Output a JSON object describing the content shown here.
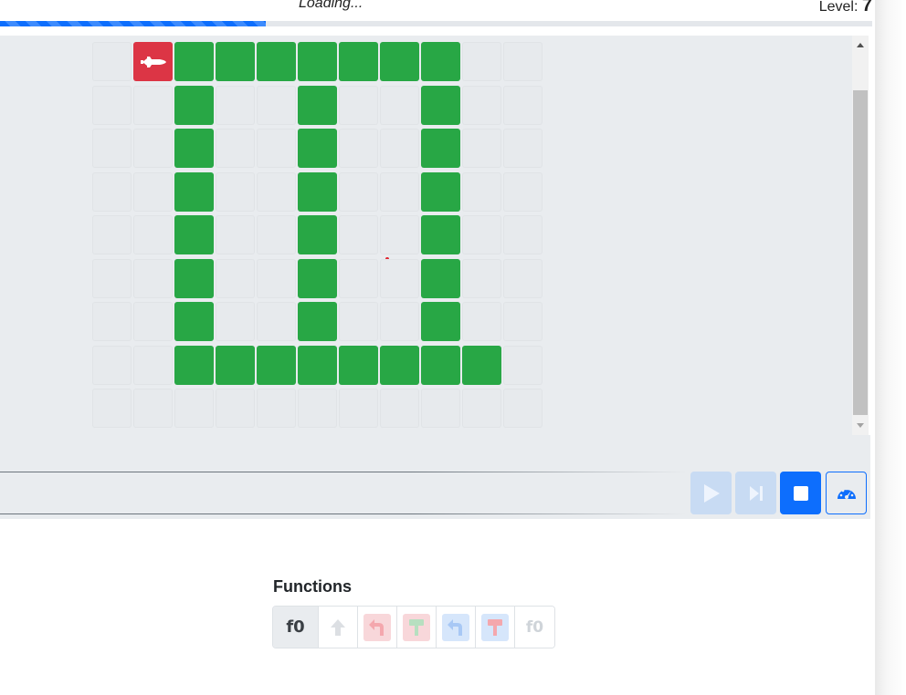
{
  "header": {
    "loading_text": "Loading...",
    "level_label": "Level:",
    "level_value": "7",
    "progress_fraction": 0.305
  },
  "board": {
    "cols": 11,
    "rows": 9,
    "grid": [
      "erggggggge",
      "eeg.eg..ge",
      "eeg.eg..ge",
      "eeg.eg..ge",
      "eeg.eg..ge",
      "eeg.eg..ge",
      "eeg.eg..ge",
      "eegggggggge",
      "eeeeeeeeeee"
    ],
    "ship_icon": "space-shuttle-icon",
    "colors": {
      "green": "#28a745",
      "red": "#dc3545",
      "empty": "#e7eaed"
    }
  },
  "controls": {
    "play_icon": "play-icon",
    "step_icon": "step-forward-icon",
    "stop_icon": "stop-icon",
    "speed_icon": "speedometer-icon",
    "accent": "#0d6efd"
  },
  "functions": {
    "label": "Functions",
    "name": "f0",
    "slots": [
      {
        "icon": "arrow-up-icon",
        "color": "none"
      },
      {
        "icon": "turn-left-icon",
        "color": "red"
      },
      {
        "icon": "paint-brush-icon",
        "color": "red"
      },
      {
        "icon": "turn-left-icon",
        "color": "blue"
      },
      {
        "icon": "paint-brush-icon",
        "color": "blue"
      },
      {
        "icon": "call-f0-icon",
        "color": "none",
        "text": "f0"
      }
    ]
  }
}
